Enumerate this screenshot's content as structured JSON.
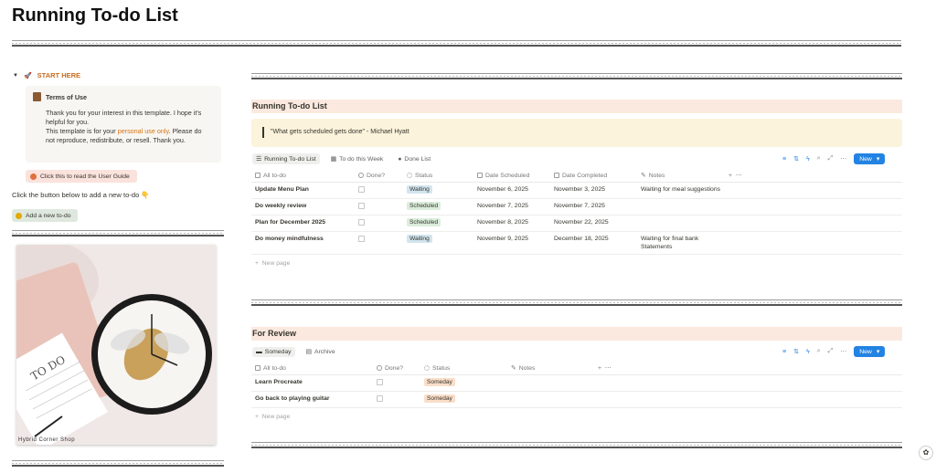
{
  "page": {
    "title": "Running To-do List"
  },
  "left": {
    "toggle_label": "START HERE",
    "terms": {
      "heading": "Terms of Use",
      "line1": "Thank you for your interest in this template. I hope it's helpful for you.",
      "line2a": "This template is for your ",
      "line2b": "personal use only",
      "line2c": ". Please do not reproduce, redistribute, or resell. Thank you."
    },
    "guide_button": "Click this to read the User Guide",
    "instruction": "Click the button below to add a new to-do 👇",
    "add_button": "Add a new to-do",
    "image_credit": "Hybrid Corner Shop",
    "image_text": "TO DO"
  },
  "running": {
    "heading": "Running To-do List",
    "quote": "\"What gets scheduled gets done\" - Michael Hyatt",
    "tabs": [
      "Running To-do List",
      "To do this Week",
      "Done List"
    ],
    "new_label": "New",
    "columns": [
      "All to-do",
      "Done?",
      "Status",
      "Date Scheduled",
      "Date Completed",
      "Notes"
    ],
    "rows": [
      {
        "name": "Update Menu Plan",
        "status": "Waiting",
        "scheduled": "November 6, 2025",
        "completed": "November 3, 2025",
        "notes": "Waiting for meal suggestions"
      },
      {
        "name": "Do weekly review",
        "status": "Scheduled",
        "scheduled": "November 7, 2025",
        "completed": "November 7, 2025",
        "notes": ""
      },
      {
        "name": "Plan for December 2025",
        "status": "Scheduled",
        "scheduled": "November 8, 2025",
        "completed": "November 22, 2025",
        "notes": ""
      },
      {
        "name": "Do money mindfulness",
        "status": "Waiting",
        "scheduled": "November 9, 2025",
        "completed": "December 18, 2025",
        "notes": "Waiting for final bank Statements"
      }
    ],
    "new_page": "New page"
  },
  "review": {
    "heading": "For Review",
    "tabs": [
      "Someday",
      "Archive"
    ],
    "new_label": "New",
    "columns": [
      "All to-do",
      "Done?",
      "Status",
      "Notes"
    ],
    "rows": [
      {
        "name": "Learn Procreate",
        "status": "Someday"
      },
      {
        "name": "Go back to playing guitar",
        "status": "Someday"
      }
    ],
    "new_page": "New page"
  },
  "colors": {
    "waiting": "#d3e5ef",
    "scheduled": "#dbeddb",
    "someday": "#fadec9",
    "accent": "#2383e2"
  }
}
